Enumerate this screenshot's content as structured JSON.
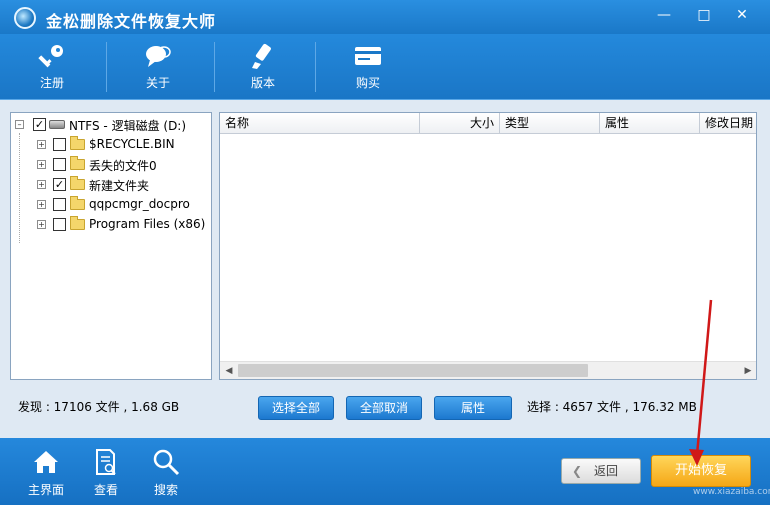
{
  "window": {
    "title": "金松删除文件恢复大师",
    "controls": [
      "minimize-icon",
      "maximize-icon",
      "close-icon"
    ]
  },
  "toolbar": {
    "items": [
      {
        "label": "注册",
        "icon": "key-icon"
      },
      {
        "label": "关于",
        "icon": "chat-bubble-icon"
      },
      {
        "label": "版本",
        "icon": "highlighter-icon"
      },
      {
        "label": "购买",
        "icon": "card-icon"
      }
    ]
  },
  "tree": {
    "root": {
      "label": "NTFS - 逻辑磁盘 (D:)",
      "checked": true,
      "expanded": true
    },
    "children": [
      {
        "label": "$RECYCLE.BIN",
        "checked": false
      },
      {
        "label": "丢失的文件0",
        "checked": false
      },
      {
        "label": "新建文件夹",
        "checked": true
      },
      {
        "label": "qqpcmgr_docpro",
        "checked": false
      },
      {
        "label": "Program Files (x86)",
        "checked": false
      }
    ]
  },
  "file_list": {
    "columns": [
      "名称",
      "大小",
      "类型",
      "属性",
      "修改日期"
    ],
    "rows": []
  },
  "status": {
    "found": "发现 : 17106 文件 , 1.68 GB",
    "selected": "选择 : 4657 文件 , 176.32 MB",
    "select_all": "选择全部",
    "deselect_all": "全部取消",
    "properties": "属性"
  },
  "bottom_nav": {
    "items": [
      {
        "label": "主界面",
        "icon": "home-icon"
      },
      {
        "label": "查看",
        "icon": "document-search-icon"
      },
      {
        "label": "搜索",
        "icon": "magnifier-icon"
      }
    ],
    "back": "返回",
    "recover": "开始恢复"
  },
  "watermark": "www.xiazaiba.com",
  "colors": {
    "primary_blue": "#1f7fd0",
    "recover_orange": "#f5a716",
    "annotation_red": "#d01818"
  }
}
